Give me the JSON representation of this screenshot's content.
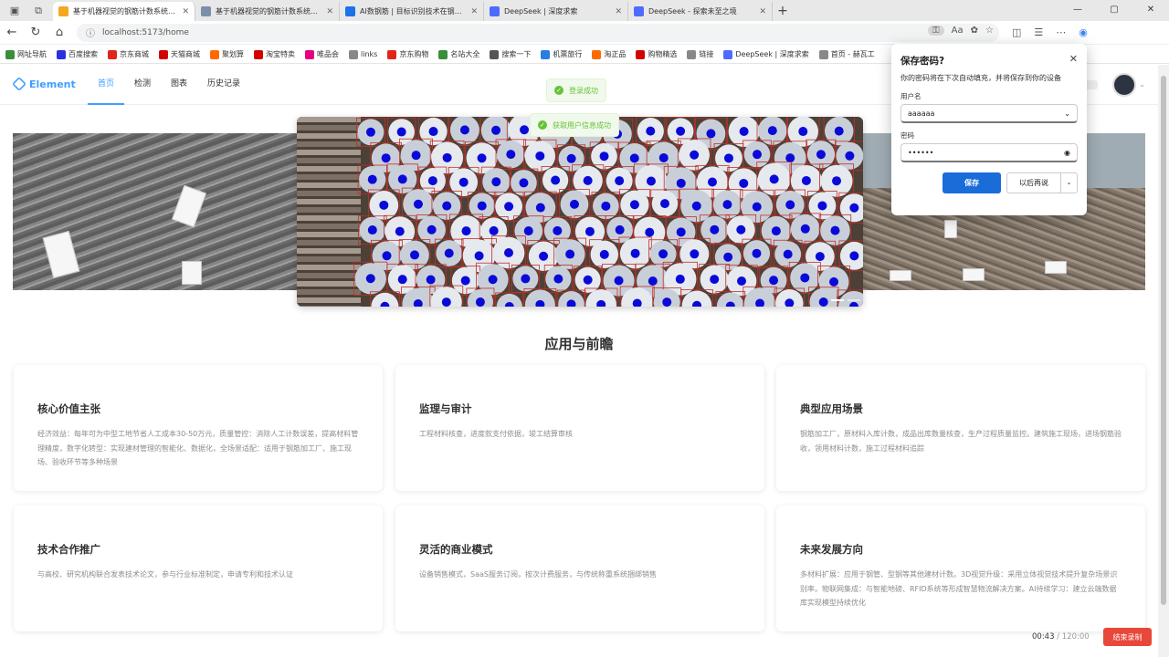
{
  "browser": {
    "tabs": [
      {
        "title": "基于机器视觉的钢筋计数系统算法",
        "active": true,
        "icon_color": "#f5a623"
      },
      {
        "title": "基于机器视觉的钢筋计数系统算法",
        "active": false,
        "icon_color": "#7c8ea8"
      },
      {
        "title": "AI数钢筋 | 目标识别技术在钢筋计",
        "active": false,
        "icon_color": "#1a73e8"
      },
      {
        "title": "DeepSeek | 深度求索",
        "active": false,
        "icon_color": "#4d6bfe"
      },
      {
        "title": "DeepSeek - 探索未至之境",
        "active": false,
        "icon_color": "#4d6bfe"
      }
    ],
    "url": "localhost:5173/home",
    "bookmarks": [
      {
        "label": "网址导航",
        "color": "#3a8d3a"
      },
      {
        "label": "百度搜索",
        "color": "#2932e1"
      },
      {
        "label": "京东商城",
        "color": "#e1251b"
      },
      {
        "label": "天猫商城",
        "color": "#d40000"
      },
      {
        "label": "聚划算",
        "color": "#ff6a00"
      },
      {
        "label": "淘宝特卖",
        "color": "#d40000"
      },
      {
        "label": "唯品会",
        "color": "#e4007f"
      },
      {
        "label": "links",
        "color": "#888888"
      },
      {
        "label": "京东购物",
        "color": "#e1251b"
      },
      {
        "label": "名站大全",
        "color": "#3a8d3a"
      },
      {
        "label": "搜索一下",
        "color": "#555555"
      },
      {
        "label": "机票旅行",
        "color": "#2a7de1"
      },
      {
        "label": "淘正品",
        "color": "#ff6a00"
      },
      {
        "label": "购物精选",
        "color": "#d40000"
      },
      {
        "label": "链接",
        "color": "#888888"
      },
      {
        "label": "DeepSeek | 深度求索",
        "color": "#4d6bfe"
      },
      {
        "label": "首页 - 赫瓦工",
        "color": "#888888"
      }
    ]
  },
  "app": {
    "logo": "Element",
    "menu": [
      "首页",
      "检测",
      "图表",
      "历史记录"
    ],
    "toast_login": "登录成功",
    "toast_userinfo": "获取用户信息成功",
    "section_title": "应用与前瞻",
    "cards": [
      {
        "title": "核心价值主张",
        "text": "经济效益：每年可为中型工地节省人工成本30-50万元，质量管控：消除人工计数误差，提高材料管理精度，数字化转型：实现建材管理的智能化、数据化，全场景适配：适用于钢筋加工厂、施工现场、验收环节等多种场景"
      },
      {
        "title": "监理与审计",
        "text": "工程材料核查，进度款支付依据，竣工结算审核"
      },
      {
        "title": "典型应用场景",
        "text": "钢筋加工厂，原材料入库计数，成品出库数量核查，生产过程质量监控。建筑施工现场，进场钢筋验收，领用材料计数，施工过程材料追踪"
      },
      {
        "title": "技术合作推广",
        "text": "与高校、研究机构联合发表技术论文，参与行业标准制定，申请专利和技术认证"
      },
      {
        "title": "灵活的商业模式",
        "text": "设备销售模式，SaaS服务订阅，按次计费服务，与传统称重系统捆绑销售"
      },
      {
        "title": "未来发展方向",
        "text": "多材料扩展：应用于钢管、型钢等其他建材计数。3D视觉升级：采用立体视觉技术提升复杂场景识别率。物联网集成：与智能地磅、RFID系统等形成智慧物流解决方案。AI持续学习：建立云端数据库实现模型持续优化"
      }
    ]
  },
  "password_dialog": {
    "title": "保存密码?",
    "desc": "你的密码将在下次自动填充，并将保存到你的设备",
    "username_label": "用户名",
    "username_value": "aaaaaa",
    "password_label": "密码",
    "password_value": "••••••",
    "save": "保存",
    "later": "以后再说"
  },
  "recording": {
    "elapsed": "00:43",
    "total": "/ 120:00",
    "stop": "结束录制"
  },
  "colors": {
    "accent": "#409eff",
    "success": "#67c23a",
    "detect_dot": "#0a0ad8",
    "detect_box": "#c0302a"
  }
}
